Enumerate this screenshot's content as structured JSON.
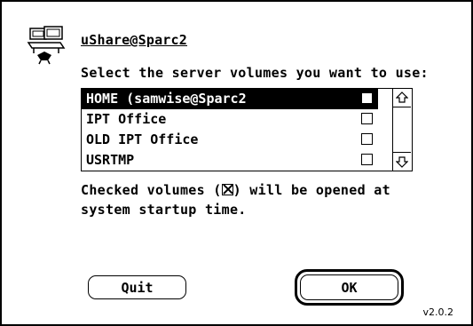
{
  "dialog": {
    "server_name": "uShare@Sparc2",
    "prompt": "Select the server volumes you want to use:",
    "icon": "network-server-icon"
  },
  "volumes": [
    {
      "label": "HOME (samwise@Sparc2",
      "selected": true,
      "checked": false
    },
    {
      "label": "IPT Office",
      "selected": false,
      "checked": false
    },
    {
      "label": "OLD IPT Office",
      "selected": false,
      "checked": false
    },
    {
      "label": "USRTMP",
      "selected": false,
      "checked": false
    }
  ],
  "note": {
    "before": "Checked volumes (",
    "after": ") will be opened at",
    "line2": "system startup time."
  },
  "buttons": {
    "quit": "Quit",
    "ok": "OK"
  },
  "version": "v2.0.2",
  "colors": {
    "foreground": "#000000",
    "background": "#ffffff"
  }
}
